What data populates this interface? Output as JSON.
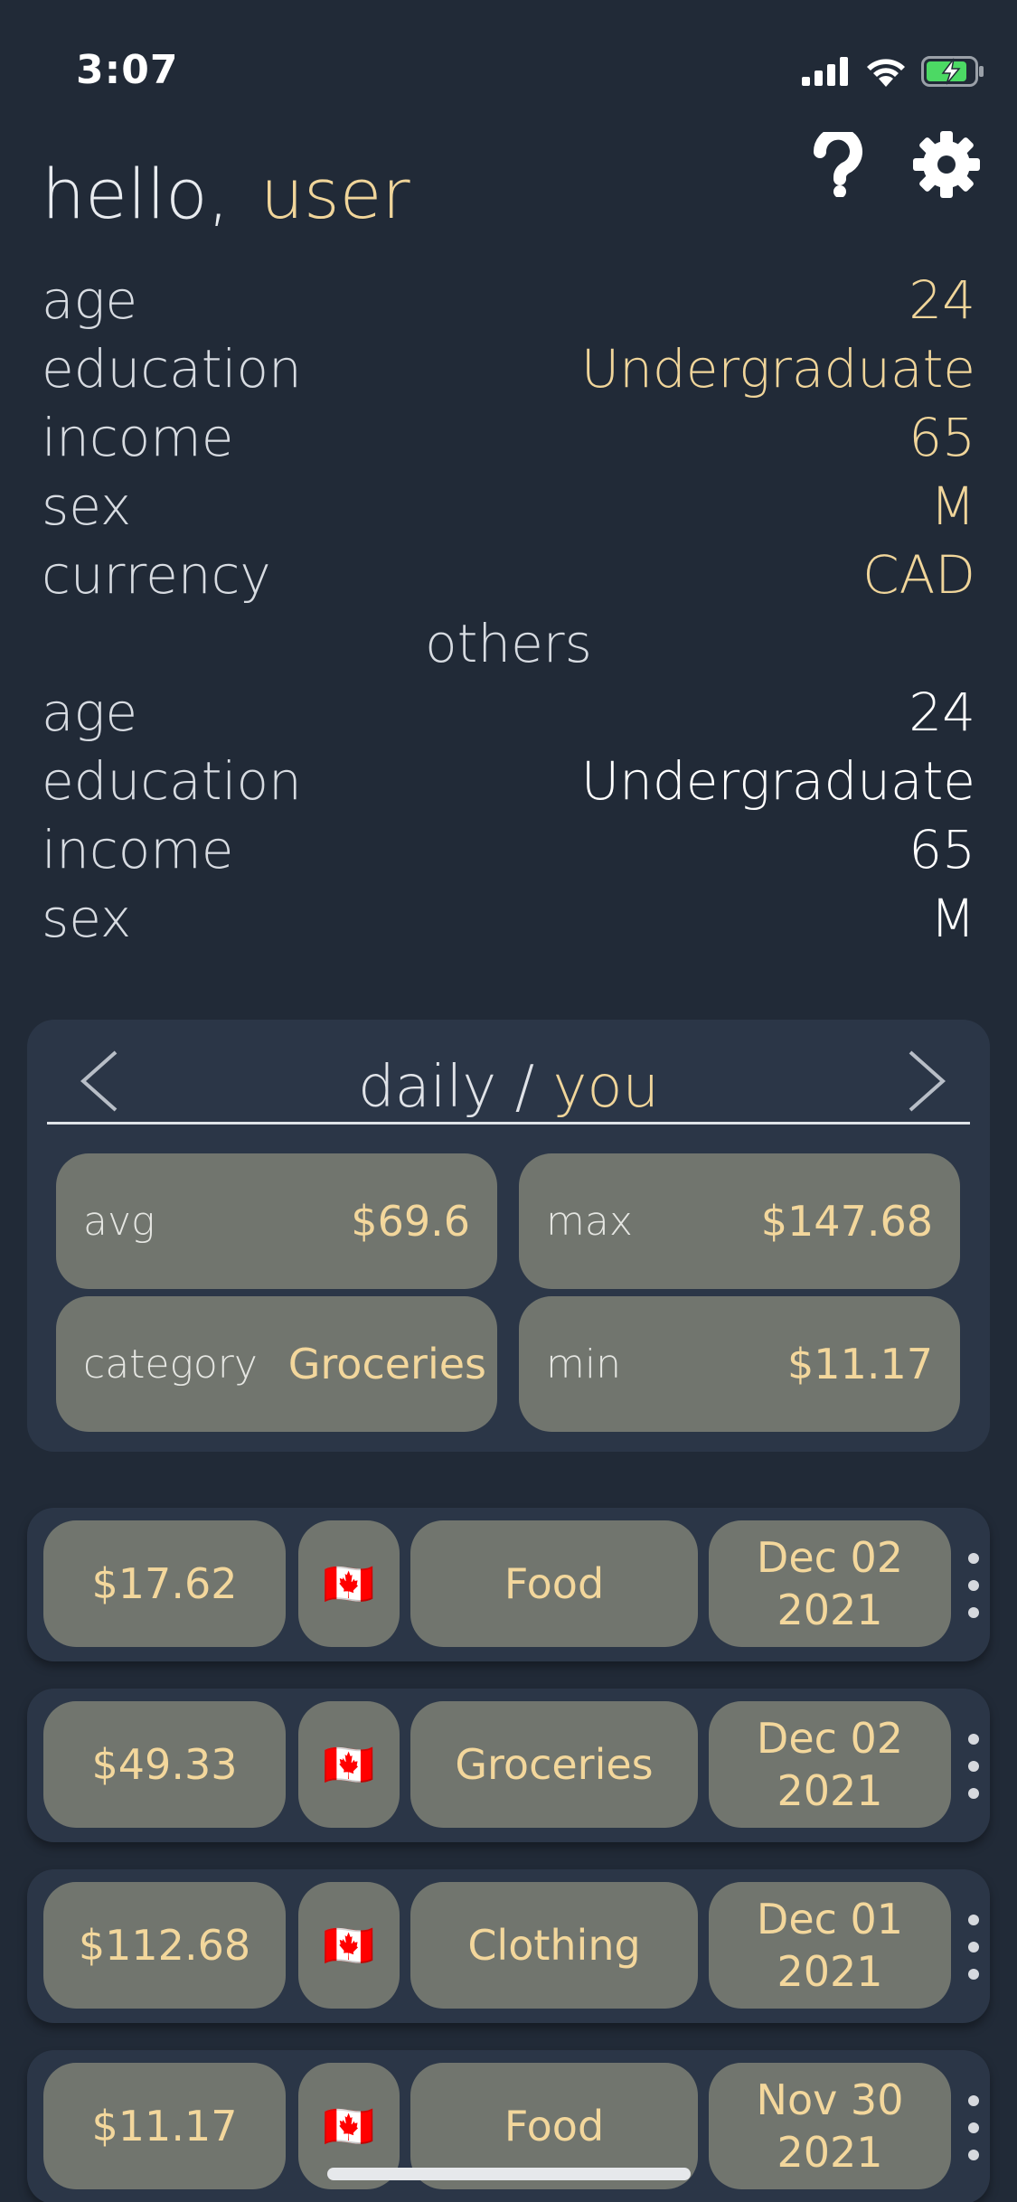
{
  "status": {
    "time": "3:07"
  },
  "greeting": {
    "hello": "hello,",
    "user": "user"
  },
  "profile": [
    {
      "label": "age",
      "value": "24"
    },
    {
      "label": "education",
      "value": "Undergraduate"
    },
    {
      "label": "income",
      "value": "65"
    },
    {
      "label": "sex",
      "value": "M"
    },
    {
      "label": "currency",
      "value": "CAD"
    }
  ],
  "others": {
    "title": "others",
    "rows": [
      {
        "label": "age",
        "value": "24"
      },
      {
        "label": "education",
        "value": "Undergraduate"
      },
      {
        "label": "income",
        "value": "65"
      },
      {
        "label": "sex",
        "value": "M"
      }
    ]
  },
  "stats": {
    "period": "daily",
    "separator": " / ",
    "scope": "you",
    "avg_label": "avg",
    "avg_value": "$69.6",
    "max_label": "max",
    "max_value": "$147.68",
    "category_label": "category",
    "category_value": "Groceries",
    "min_label": "min",
    "min_value": "$11.17"
  },
  "transactions": [
    {
      "amount": "$17.62",
      "flag": "🇨🇦",
      "category": "Food",
      "date_line1": "Dec 02",
      "date_line2": "2021"
    },
    {
      "amount": "$49.33",
      "flag": "🇨🇦",
      "category": "Groceries",
      "date_line1": "Dec 02",
      "date_line2": "2021"
    },
    {
      "amount": "$112.68",
      "flag": "🇨🇦",
      "category": "Clothing",
      "date_line1": "Dec 01",
      "date_line2": "2021"
    },
    {
      "amount": "$11.17",
      "flag": "🇨🇦",
      "category": "Food",
      "date_line1": "Nov 30",
      "date_line2": "2021"
    }
  ],
  "icons": {
    "help": "help-icon",
    "settings": "gear-icon",
    "prev": "chevron-left-icon",
    "next": "chevron-right-icon",
    "more": "more-vertical-icon"
  },
  "colors": {
    "background": "#212a37",
    "card": "#2b3647",
    "tile": "#71756e",
    "accent": "#f0d59a"
  }
}
